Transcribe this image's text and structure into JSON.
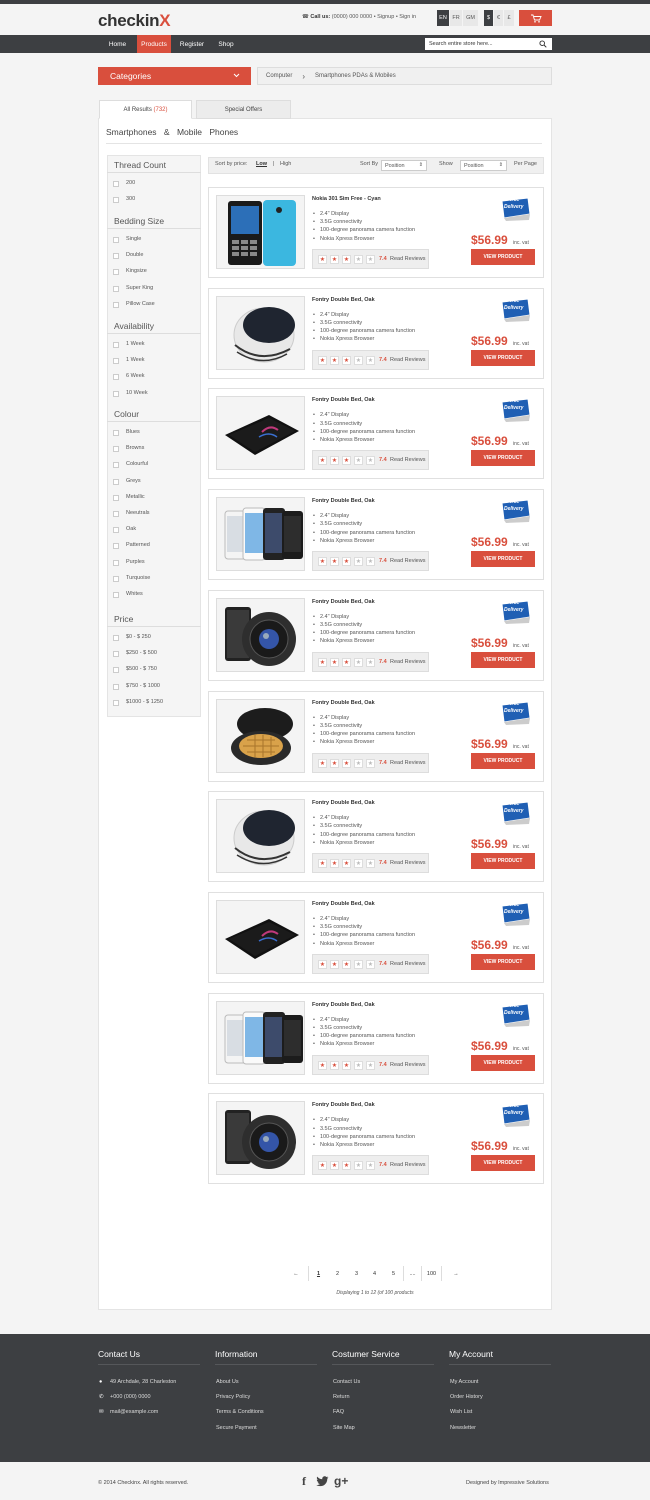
{
  "header": {
    "logo": "checkin",
    "logo_mark": "X",
    "call_label": "Call us:",
    "phone": "(0000) 000 0000",
    "signup": "Signup",
    "signin": "Sign in",
    "languages": [
      "EN",
      "FR",
      "GM"
    ],
    "currencies": [
      "$",
      "€",
      "£"
    ],
    "icons": {
      "phone": "phone-icon",
      "cart": "cart-icon",
      "search": "search-icon"
    }
  },
  "nav": {
    "items": [
      "Home",
      "Products",
      "Register",
      "Shop"
    ],
    "active": "Products",
    "search_placeholder": "Search entire store here..."
  },
  "categories": {
    "label": "Categories"
  },
  "breadcrumb": [
    "Computer",
    "Smartphones PDAs & Mobiles"
  ],
  "tabs": [
    {
      "label": "All Results",
      "count": "(732)"
    },
    {
      "label": "Special Offers"
    }
  ],
  "heading": "Smartphones   &   Mobile Phones",
  "filters": [
    {
      "title": "Thread Count",
      "options": [
        "200",
        "300"
      ]
    },
    {
      "title": "Bedding Size",
      "options": [
        "Single",
        "Double",
        "Kingsize",
        "Super King",
        "Pillow Case"
      ]
    },
    {
      "title": "Availability",
      "options": [
        "1 Week",
        "1 Week",
        "6 Week",
        "10 Week"
      ]
    },
    {
      "title": "Colour",
      "options": [
        "Blues",
        "Browns",
        "Colourful",
        "Greys",
        "Metallic",
        "Neeutrals",
        "Oak",
        "Patterned",
        "Purples",
        "Turquoise",
        "Whites"
      ]
    },
    {
      "title": "Price",
      "options": [
        "$0 - $ 250",
        "$250 - $ 500",
        "$500 - $ 750",
        "$750 - $ 1000",
        "$1000 - $ 1250"
      ]
    }
  ],
  "sort": {
    "by_price": "Sort by price:",
    "low": "Low",
    "sep": "|",
    "high": "High",
    "sort_by": "Sort By",
    "sort_value": "Position",
    "show": "Show",
    "show_value": "Position",
    "per_page": "Per Page"
  },
  "product_common": {
    "features": [
      "2.4\" Display",
      "3.5G connectivity",
      "100-degree panorama camera function",
      "Nokia Xpress Browser"
    ],
    "score": "7.4",
    "reviews": "Read Reviews",
    "price": "$56.99",
    "vat": "inc. vat",
    "button": "VIEW PRODUCT",
    "badge_line1": "free",
    "badge_line2": "Delivery",
    "rating": 3,
    "rating_max": 5
  },
  "products": [
    {
      "title": "Nokia 301 Sim Free - Cyan",
      "image": "blue-phone"
    },
    {
      "title": "Fontry Double Bed, Oak",
      "image": "speaker"
    },
    {
      "title": "Fontry Double Bed, Oak",
      "image": "tablet"
    },
    {
      "title": "Fontry Double Bed, Oak",
      "image": "iphones"
    },
    {
      "title": "Fontry Double Bed, Oak",
      "image": "lens-camera"
    },
    {
      "title": "Fontry Double Bed, Oak",
      "image": "waffle-maker"
    },
    {
      "title": "Fontry Double Bed, Oak",
      "image": "speaker"
    },
    {
      "title": "Fontry Double Bed, Oak",
      "image": "tablet"
    },
    {
      "title": "Fontry Double Bed, Oak",
      "image": "iphones"
    },
    {
      "title": "Fontry Double Bed, Oak",
      "image": "lens-camera"
    }
  ],
  "pagination": {
    "prev": "←",
    "pages": [
      "1",
      "2",
      "3",
      "4",
      "5"
    ],
    "ellipsis": "....",
    "last": "100",
    "next": "→",
    "current": "1",
    "displaying": "Displaying 1 to 12 (of 100 products"
  },
  "footer": {
    "columns": [
      {
        "title": "Contact Us",
        "items": [
          "49 Archdale, 28 Charleston",
          "+000 (000) 0000",
          "mail@example.com"
        ]
      },
      {
        "title": "Information",
        "items": [
          "About Us",
          "Privacy Policy",
          "Terms & Conditions",
          "Secure Payment"
        ]
      },
      {
        "title": "Costumer Service",
        "items": [
          "Contact Us",
          "Return",
          "FAQ",
          "Site Map"
        ]
      },
      {
        "title": "My Account",
        "items": [
          "My Account",
          "Order History",
          "Wish List",
          "Newsletter"
        ]
      }
    ],
    "copyright": "© 2014 Checkinx. All rights reserved.",
    "designed": "Designed by Impressive Solutions",
    "social": [
      "f",
      "t",
      "g+"
    ]
  }
}
